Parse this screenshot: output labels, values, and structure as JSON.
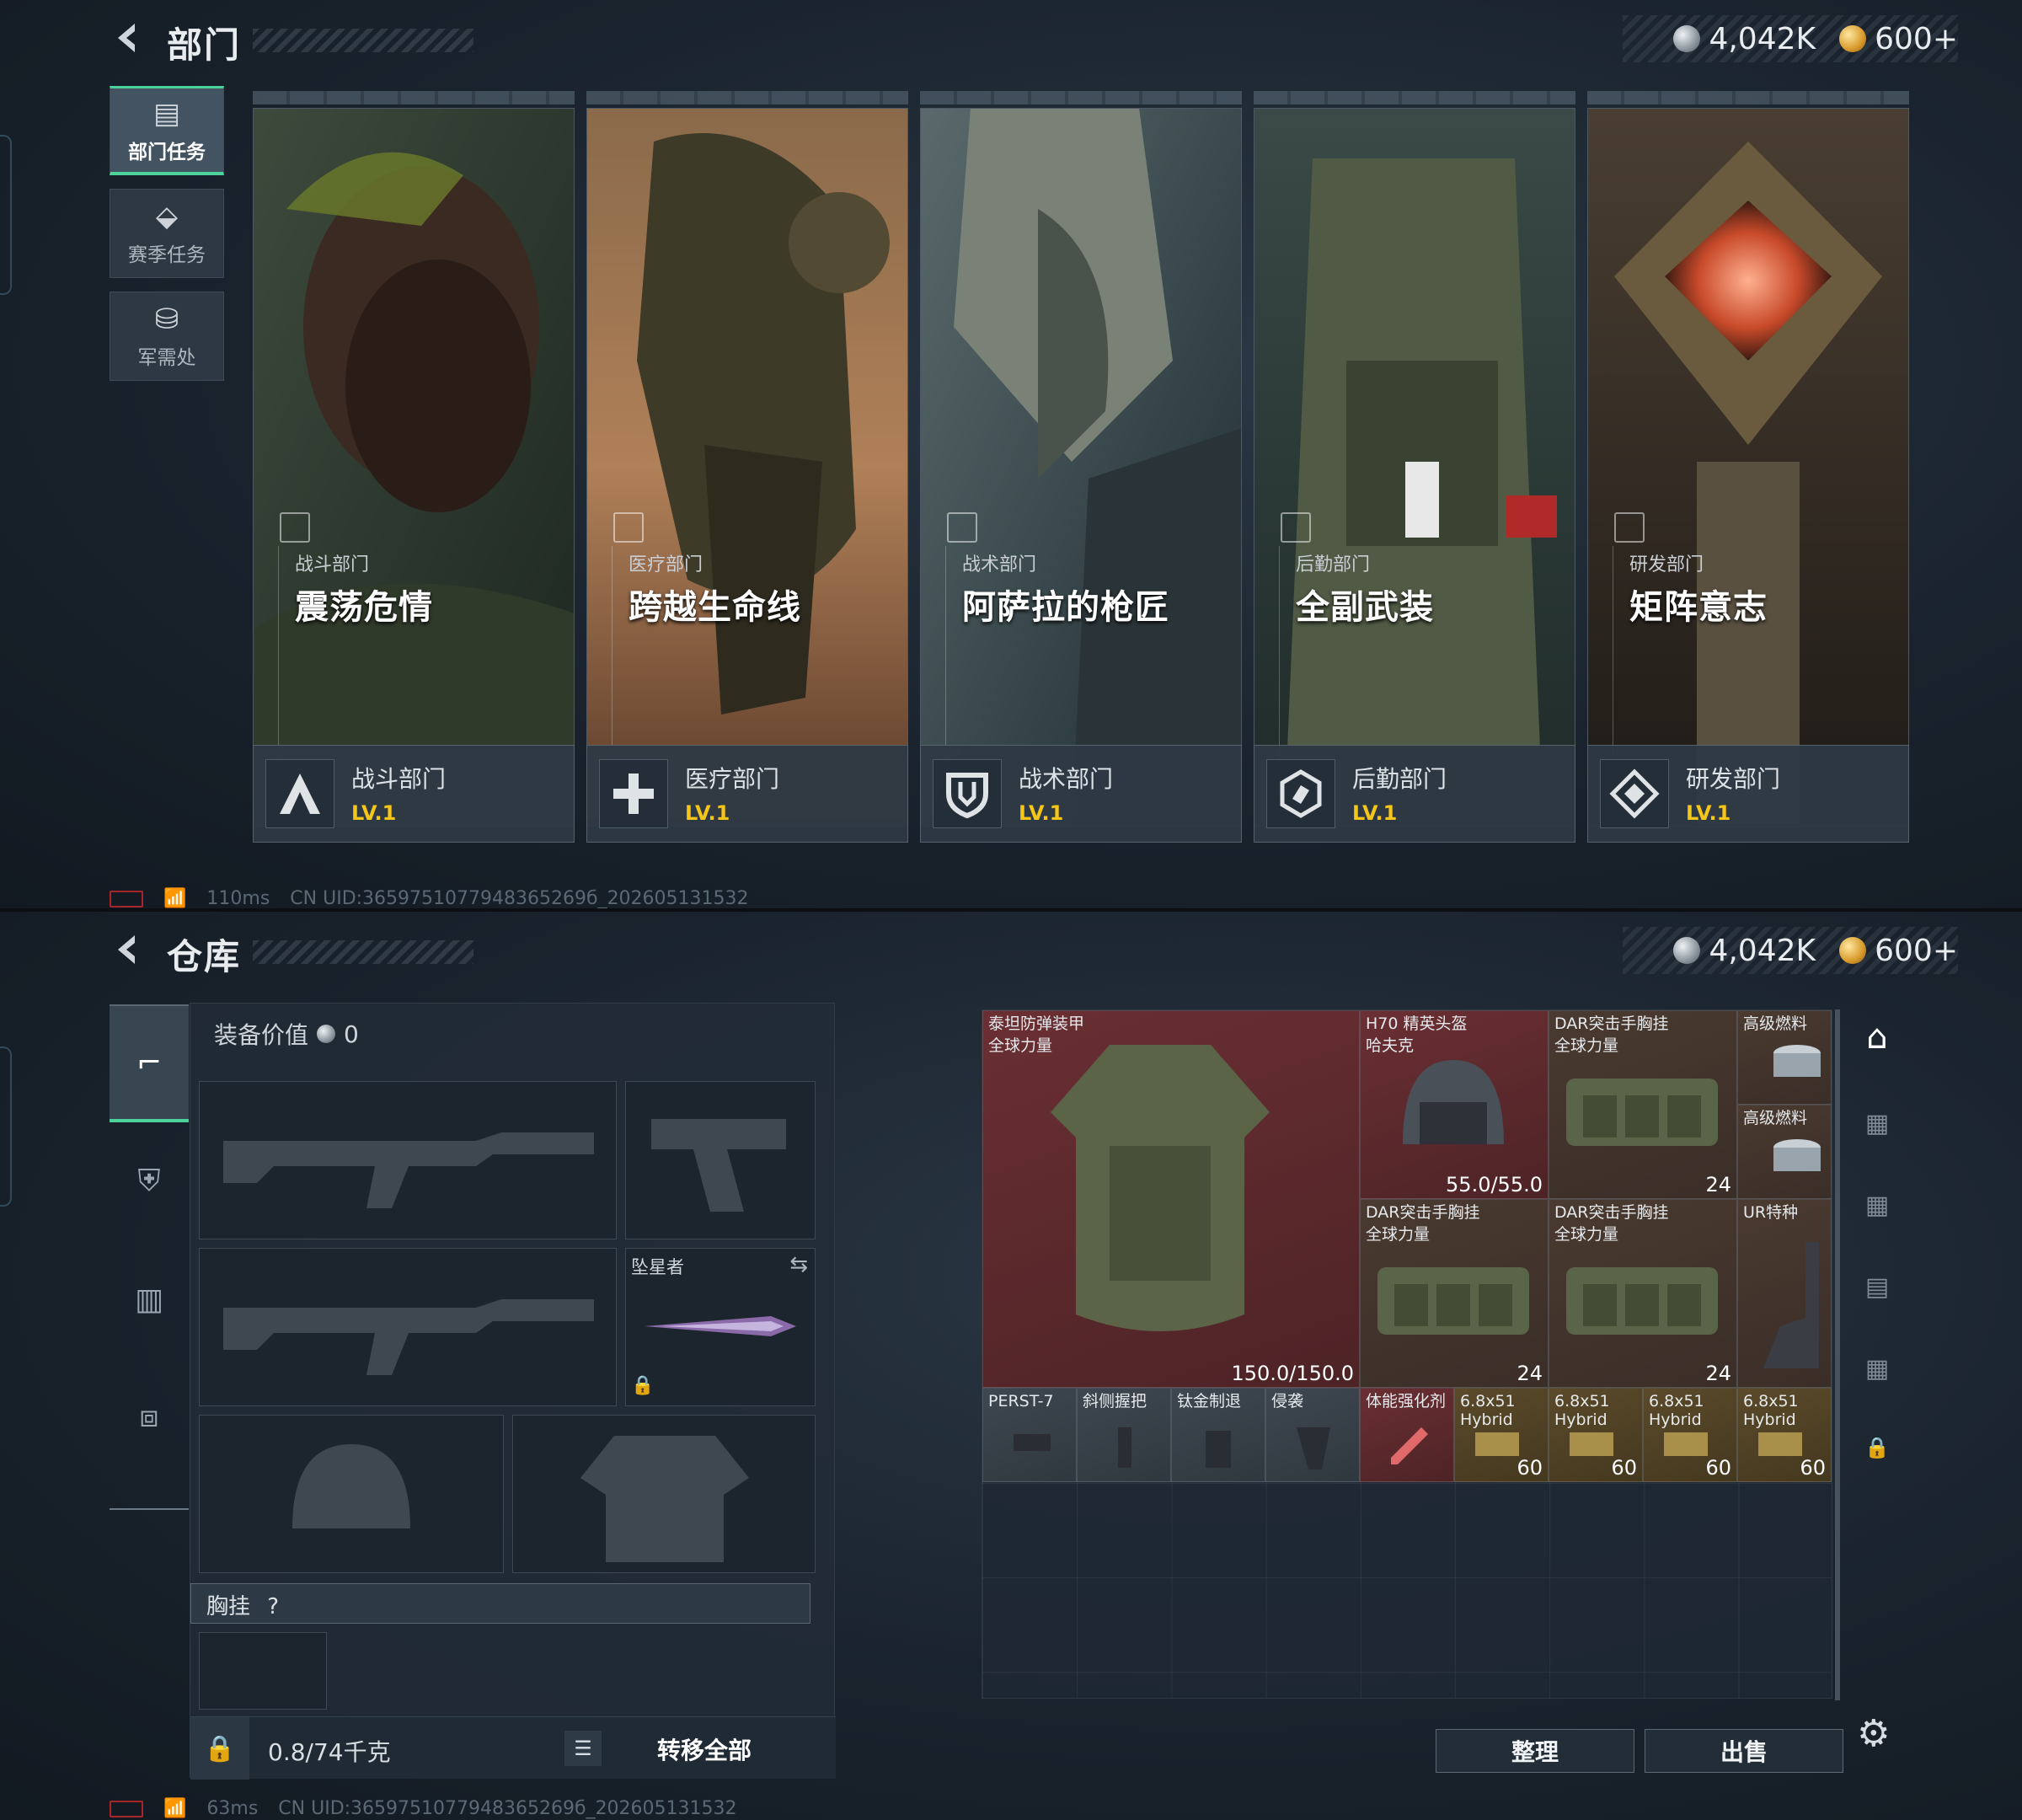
{
  "top": {
    "title": "部门",
    "currency": {
      "silver": "4,042K",
      "gold": "600+"
    },
    "sidetabs": [
      {
        "label": "部门任务",
        "icon": "mission-doc-icon"
      },
      {
        "label": "赛季任务",
        "icon": "season-box-icon"
      },
      {
        "label": "军需处",
        "icon": "coin-stack-icon"
      }
    ],
    "cards": [
      {
        "sub": "战斗部门",
        "name": "震荡危情",
        "dept": "战斗部门",
        "level": "LV.1",
        "icon": "combat-dept-icon"
      },
      {
        "sub": "医疗部门",
        "name": "跨越生命线",
        "dept": "医疗部门",
        "level": "LV.1",
        "icon": "medical-dept-icon"
      },
      {
        "sub": "战术部门",
        "name": "阿萨拉的枪匠",
        "dept": "战术部门",
        "level": "LV.1",
        "icon": "tactical-dept-icon"
      },
      {
        "sub": "后勤部门",
        "name": "全副武装",
        "dept": "后勤部门",
        "level": "LV.1",
        "icon": "logistics-dept-icon"
      },
      {
        "sub": "研发部门",
        "name": "矩阵意志",
        "dept": "研发部门",
        "level": "LV.1",
        "icon": "rnd-dept-icon"
      }
    ],
    "status": {
      "ping": "110ms",
      "uid": "CN UID:3659751077948365269б_202605131532"
    }
  },
  "bottom": {
    "title": "仓库",
    "currency": {
      "silver": "4,042K",
      "gold": "600+"
    },
    "equip_value_label": "装备价值",
    "equip_value": "0",
    "melee_name": "坠星者",
    "chest_label": "胸挂",
    "chest_hint": "?",
    "weight": "0.8/74千克",
    "transfer_all": "转移全部",
    "items": [
      {
        "n1": "泰坦防弹装甲",
        "n2": "全球力量",
        "q": "150.0/150.0",
        "tone": "red"
      },
      {
        "n1": "H70 精英头盔",
        "n2": "哈夫克",
        "q": "55.0/55.0",
        "tone": "red"
      },
      {
        "n1": "DAR突击手胸挂",
        "n2": "全球力量",
        "q": "24",
        "tone": "brown"
      },
      {
        "n1": "高级燃料",
        "n2": "",
        "q": "",
        "tone": "brown"
      },
      {
        "n1": "高级燃料",
        "n2": "",
        "q": "",
        "tone": "brown"
      },
      {
        "n1": "DAR突击手胸挂",
        "n2": "全球力量",
        "q": "24",
        "tone": "brown"
      },
      {
        "n1": "DAR突击手胸挂",
        "n2": "全球力量",
        "q": "24",
        "tone": "brown"
      },
      {
        "n1": "UR特种",
        "n2": "",
        "q": "",
        "tone": "brown"
      },
      {
        "n1": "PERST-7",
        "n2": "",
        "q": "",
        "tone": "gray"
      },
      {
        "n1": "斜侧握把",
        "n2": "",
        "q": "",
        "tone": "gray"
      },
      {
        "n1": "钛金制退",
        "n2": "",
        "q": "",
        "tone": "gray"
      },
      {
        "n1": "侵袭",
        "n2": "",
        "q": "",
        "tone": "gray"
      },
      {
        "n1": "体能强化剂",
        "n2": "",
        "q": "",
        "tone": "red"
      },
      {
        "n1": "6.8x51",
        "n2": "Hybrid",
        "q": "60",
        "tone": "gold"
      },
      {
        "n1": "6.8x51",
        "n2": "Hybrid",
        "q": "60",
        "tone": "gold"
      },
      {
        "n1": "6.8x51",
        "n2": "Hybrid",
        "q": "60",
        "tone": "gold"
      },
      {
        "n1": "6.8x51",
        "n2": "Hybrid",
        "q": "60",
        "tone": "gold"
      }
    ],
    "buttons": {
      "sort": "整理",
      "sell": "出售"
    },
    "status": {
      "ping": "63ms",
      "uid": "CN UID:3659751077948365269б_202605131532"
    }
  }
}
